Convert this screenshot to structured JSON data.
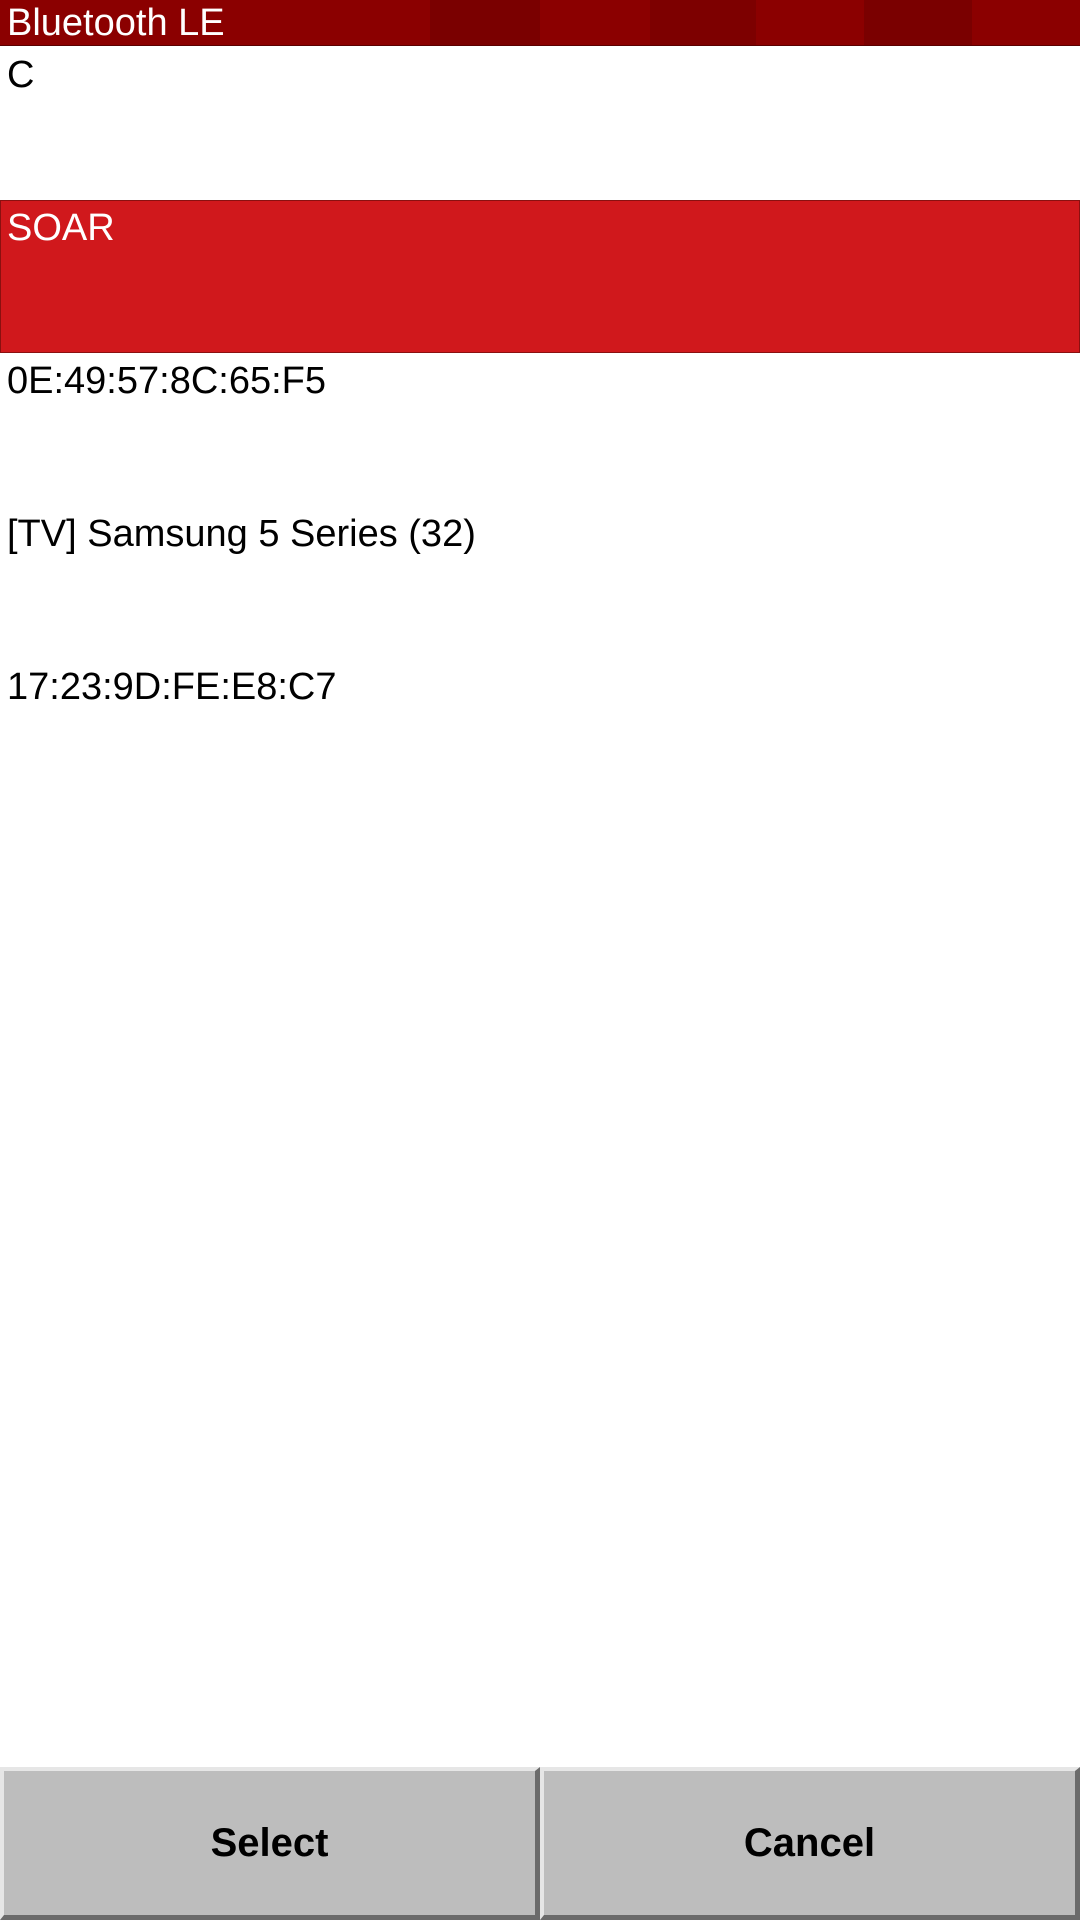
{
  "window": {
    "title": "Bluetooth LE"
  },
  "device_list": {
    "items": [
      {
        "label": "C",
        "selected": false
      },
      {
        "label": "SOAR",
        "selected": true
      },
      {
        "label": "0E:49:57:8C:65:F5",
        "selected": false
      },
      {
        "label": "[TV] Samsung 5 Series (32)",
        "selected": false
      },
      {
        "label": "17:23:9D:FE:E8:C7",
        "selected": false
      }
    ]
  },
  "buttons": {
    "select_label": "Select",
    "cancel_label": "Cancel"
  },
  "colors": {
    "title_bar": "#8b0000",
    "selected_item": "#d0181c",
    "button_face": "#bdbdbd"
  }
}
